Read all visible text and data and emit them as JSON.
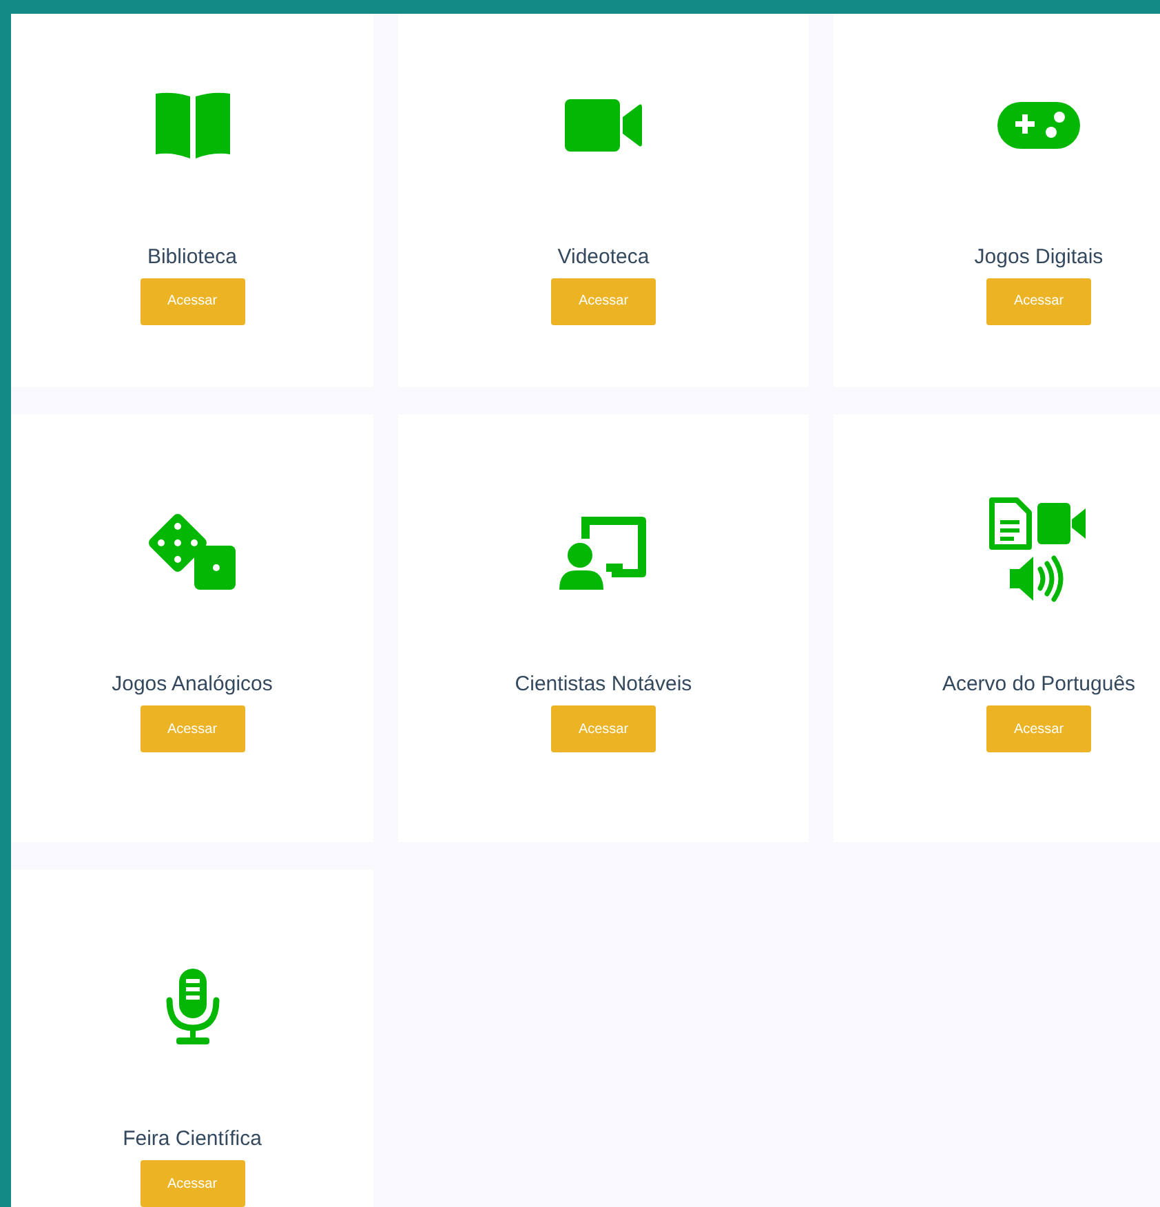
{
  "cards": [
    {
      "kind": "book",
      "title": "Biblioteca",
      "button": "Acessar"
    },
    {
      "kind": "video",
      "title": "Videoteca",
      "button": "Acessar"
    },
    {
      "kind": "gamepad",
      "title": "Jogos Digitais",
      "button": "Acessar"
    },
    {
      "kind": "dice",
      "title": "Jogos Analógicos",
      "button": "Acessar"
    },
    {
      "kind": "teacher",
      "title": "Cientistas Notáveis",
      "button": "Acessar"
    },
    {
      "kind": "media",
      "title": "Acervo do Português",
      "button": "Acessar"
    },
    {
      "kind": "mic",
      "title": "Feira Científica",
      "button": "Acessar"
    }
  ]
}
